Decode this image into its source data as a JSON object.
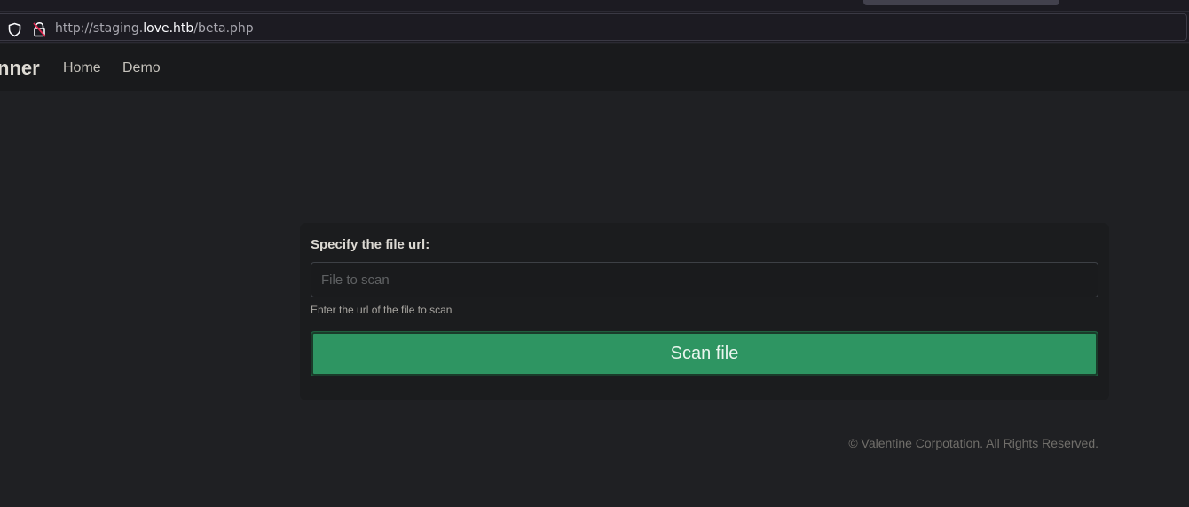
{
  "browser": {
    "url_prefix": "http://staging.",
    "url_host": "love.htb",
    "url_suffix": "/beta.php"
  },
  "navbar": {
    "brand": "nner",
    "links": [
      "Home",
      "Demo"
    ]
  },
  "form": {
    "label": "Specify the file url:",
    "input_placeholder": "File to scan",
    "input_value": "",
    "help_text": "Enter the url of the file to scan",
    "submit_label": "Scan file"
  },
  "footer": {
    "text": "© Valentine Corpotation. All Rights Reserved."
  },
  "colors": {
    "page_bg": "#1f2023",
    "navbar_bg": "#191a1c",
    "button_green": "#2e9562"
  },
  "icons": {
    "tracking": "shield-icon",
    "connection": "insecure-lock-icon"
  }
}
